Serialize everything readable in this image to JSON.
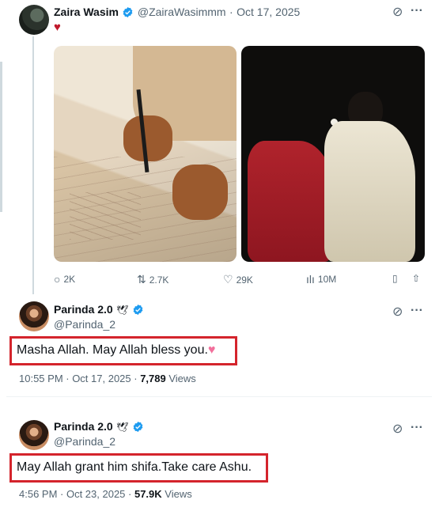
{
  "post": {
    "author_name": "Zaira Wasim",
    "handle": "@ZairaWasimmm",
    "separator": "·",
    "date": "Oct 17, 2025",
    "content_emoji": "♥",
    "stats": {
      "replies": "2K",
      "reposts": "2.7K",
      "likes": "29K",
      "views": "10M"
    }
  },
  "replies": [
    {
      "author_name": "Parinda 2.0",
      "name_emoji": "🕊",
      "handle": "@Parinda_2",
      "text": "Masha Allah. May Allah bless you.",
      "text_emoji": "♥",
      "time": "10:55 PM · Oct 17, 2025 · ",
      "views_count": "7,789",
      "views_label": " Views"
    },
    {
      "author_name": "Parinda 2.0",
      "name_emoji": "🕊",
      "handle": "@Parinda_2",
      "text": "May Allah grant him shifa.Take care Ashu.",
      "time": "4:56 PM · Oct 23, 2025 · ",
      "views_count": "57.9K",
      "views_label": " Views"
    }
  ],
  "icons": {
    "grok": "⊘",
    "more": "···",
    "reply": "○",
    "repost": "⇅",
    "like": "♡",
    "views": "ılı",
    "bookmark": "▯",
    "share": "⇧"
  },
  "colors": {
    "verified": "#1d9bf0",
    "highlight_box": "#d4242c",
    "heart_red": "#c0192c",
    "heart_pink": "#f2709c"
  }
}
